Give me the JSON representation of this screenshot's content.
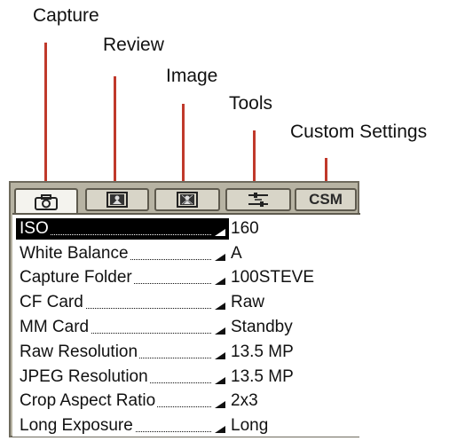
{
  "callouts": {
    "capture": "Capture",
    "review": "Review",
    "image": "Image",
    "tools": "Tools",
    "custom": "Custom Settings"
  },
  "tabs": [
    {
      "id": "capture",
      "icon": "camera-icon",
      "active": true
    },
    {
      "id": "review",
      "icon": "review-icon",
      "active": false
    },
    {
      "id": "image",
      "icon": "image-icon",
      "active": false
    },
    {
      "id": "tools",
      "icon": "tools-icon",
      "active": false
    },
    {
      "id": "custom",
      "label": "CSM",
      "active": false
    }
  ],
  "menu": {
    "items": [
      {
        "label": "ISO",
        "value": "160",
        "selected": true
      },
      {
        "label": "White Balance",
        "value": "A",
        "selected": false
      },
      {
        "label": "Capture Folder",
        "value": "100STEVE",
        "selected": false
      },
      {
        "label": "CF Card",
        "value": "Raw",
        "selected": false
      },
      {
        "label": "MM Card",
        "value": "Standby",
        "selected": false
      },
      {
        "label": "Raw Resolution",
        "value": "13.5 MP",
        "selected": false
      },
      {
        "label": "JPEG Resolution",
        "value": "13.5 MP",
        "selected": false
      },
      {
        "label": "Crop Aspect Ratio",
        "value": "2x3",
        "selected": false
      },
      {
        "label": "Long Exposure",
        "value": "Long",
        "selected": false
      }
    ]
  },
  "colors": {
    "leader": "#c0392b",
    "frame": "#b7b3a3",
    "selected_bg": "#000000"
  }
}
